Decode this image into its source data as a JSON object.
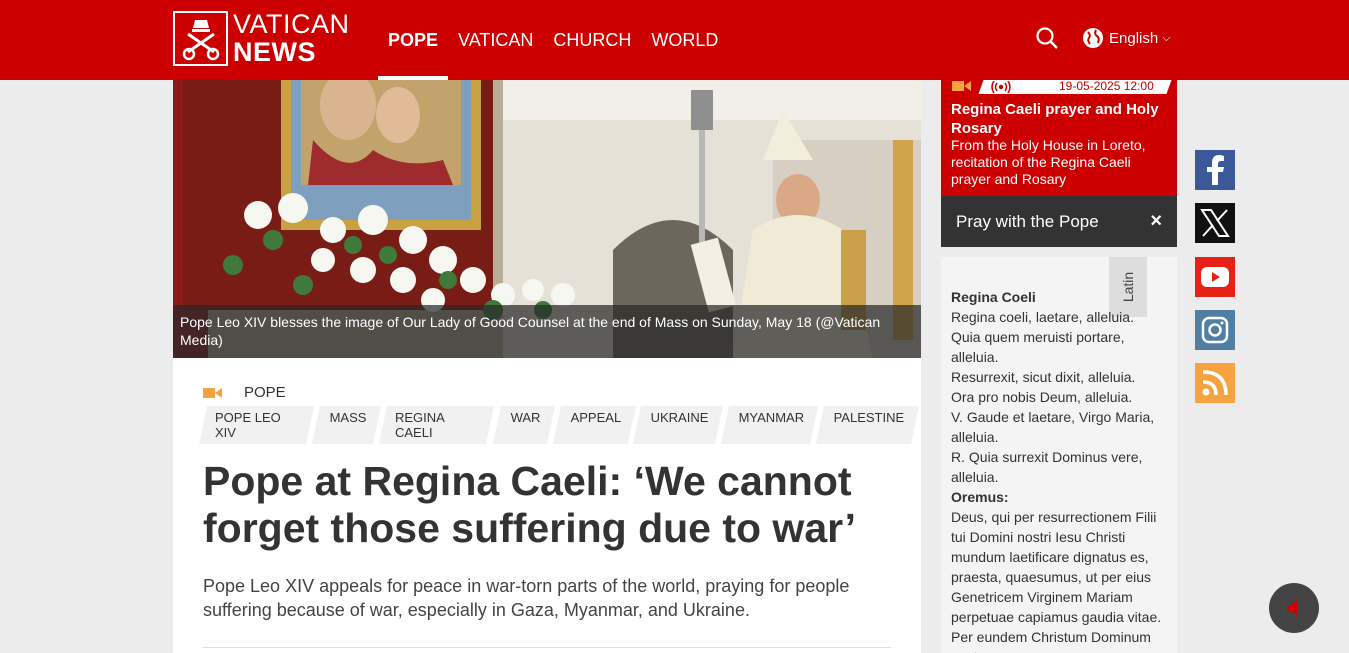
{
  "header": {
    "logo_line1": "VATICAN",
    "logo_line2": "NEWS",
    "nav": [
      "POPE",
      "VATICAN",
      "CHURCH",
      "WORLD"
    ],
    "active_nav": "POPE",
    "language": "English",
    "brand_color": "#cc0000"
  },
  "hero": {
    "caption": "Pope Leo XIV blesses the image of Our Lady of Good Counsel at the end of Mass on Sunday, May 18  (@Vatican Media)"
  },
  "article": {
    "section": "POPE",
    "tags": [
      "POPE LEO XIV",
      "MASS",
      "REGINA CAELI",
      "WAR",
      "APPEAL",
      "UKRAINE",
      "MYANMAR",
      "PALESTINE"
    ],
    "title": "Pope at Regina Caeli: ‘We cannot forget those suffering due to war’",
    "lead": "Pope Leo XIV appeals for peace in war-torn parts of the world, praying for people suffering because of war, especially in Gaza, Myanmar, and Ukraine."
  },
  "live": {
    "datetime": "19-05-2025 12:00",
    "title": "Regina Caeli prayer and Holy Rosary",
    "description": "From the Holy House in Loreto, recitation of the Regina Caeli prayer and Rosary"
  },
  "pray": {
    "label": "Pray with the Pope",
    "close": "×"
  },
  "prayer": {
    "language_tab": "Latin",
    "heading": "Regina Coeli",
    "lines": [
      "Regina coeli, laetare, alleluia.",
      "Quia quem meruisti portare, alleluia.",
      "Resurrexit, sicut dixit, alleluia.",
      "Ora pro nobis Deum, alleluia.",
      "V. Gaude et laetare, Virgo Maria, alleluia.",
      "R. Quia surrexit Dominus vere, alleluia."
    ],
    "oremus": "Oremus:",
    "oremus_text": "Deus, qui per resurrectionem Filii tui Domini nostri Iesu Christi mundum laetificare dignatus es, praesta, quaesumus, ut per eius Genetricem Virginem Mariam perpetuae capiamus gaudia vitae. Per eundem Christum Dominum nostrum."
  },
  "social": [
    "facebook-icon",
    "x-icon",
    "youtube-icon",
    "instagram-icon",
    "rss-icon"
  ]
}
